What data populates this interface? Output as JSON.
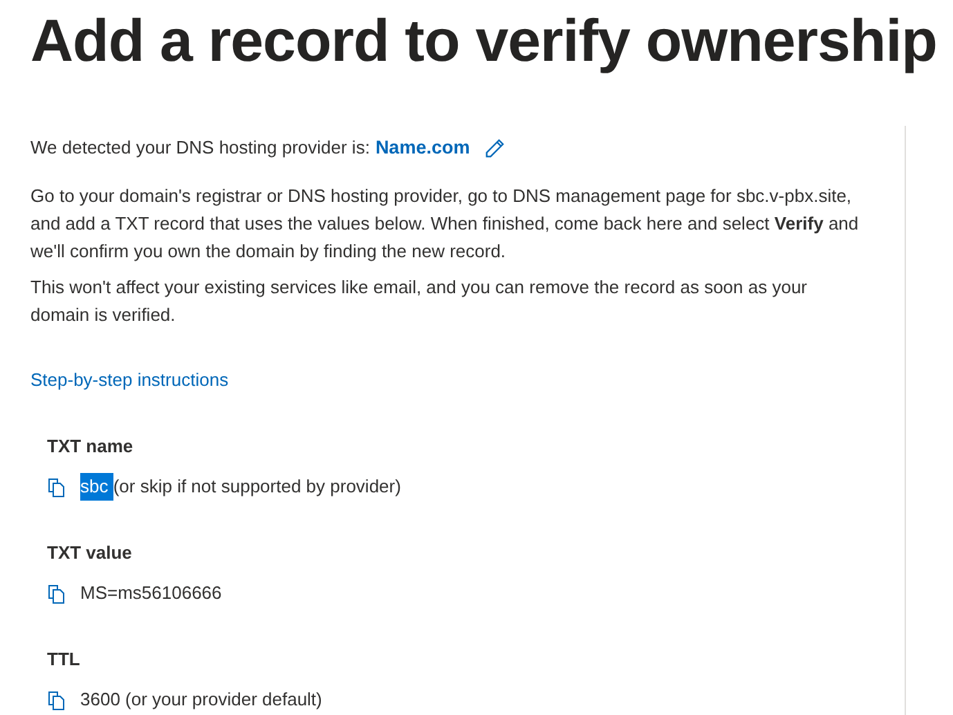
{
  "title": "Add a record to verify ownership",
  "provider": {
    "text": "We detected your DNS hosting provider is:",
    "name": "Name.com"
  },
  "paragraphs": [
    "Go to your domain's registrar or DNS hosting provider, go to DNS management page for sbc.v-pbx.site, and add a TXT record that uses the values below. When finished, come back here and select **Verify** and we'll confirm you own the domain by finding the new record.",
    "This won't affect your existing services like email, and you can remove the record as soon as your domain is verified."
  ],
  "link": "Step-by-step instructions",
  "records": [
    {
      "label": "TXT name",
      "value": "sbc",
      "selected": true,
      "note": "(or skip if not supported by provider)"
    },
    {
      "label": "TXT value",
      "value": "MS=ms56106666",
      "selected": false
    },
    {
      "label": "TTL",
      "value": "3600 (or your provider default)",
      "selected": false
    }
  ]
}
